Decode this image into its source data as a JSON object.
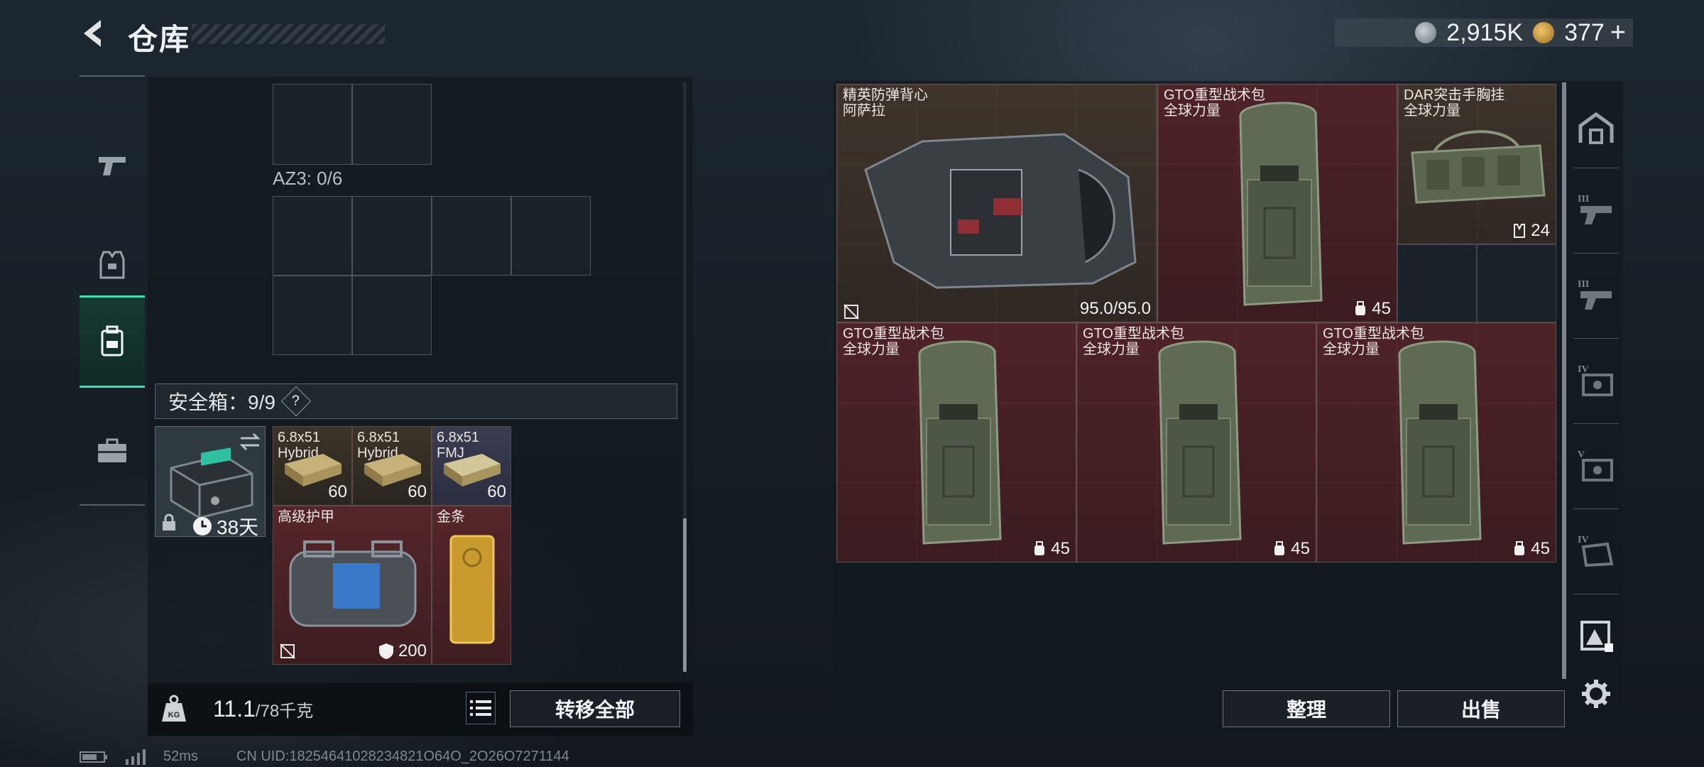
{
  "header": {
    "title": "仓库",
    "currency_1": "2,915K",
    "currency_2": "377",
    "plus": "+"
  },
  "left_storage": {
    "az3_label": "AZ3: 0/6",
    "safebox_label": "安全箱：9/9",
    "safebox_help": "?",
    "case_timer": "38天",
    "items": [
      {
        "name": "6.8x51\nHybrid",
        "count": "60"
      },
      {
        "name": "6.8x51\nHybrid",
        "count": "60"
      },
      {
        "name": "6.8x51\nFMJ",
        "count": "60"
      },
      {
        "name": "高级护甲",
        "count": "200"
      },
      {
        "name": "金条",
        "count": ""
      }
    ],
    "weight_current": "11.1",
    "weight_max": "/78千克",
    "transfer_all": "转移全部"
  },
  "right_storage": {
    "items": [
      {
        "name": "精英防弹背心",
        "sub": "阿萨拉",
        "value": "95.0/95.0"
      },
      {
        "name": "GTO重型战术包",
        "sub": "全球力量",
        "value": "45"
      },
      {
        "name": "DAR突击手胸挂",
        "sub": "全球力量",
        "value": "24"
      },
      {
        "name": "GTO重型战术包",
        "sub": "全球力量",
        "value": "45"
      },
      {
        "name": "GTO重型战术包",
        "sub": "全球力量",
        "value": "45"
      },
      {
        "name": "GTO重型战术包",
        "sub": "全球力量",
        "value": "45"
      }
    ],
    "sort_label": "整理",
    "sell_label": "出售"
  },
  "right_nav": {
    "tier_labels": [
      "III",
      "III",
      "IV",
      "V",
      "IV"
    ]
  },
  "status": {
    "ping": "52ms",
    "uid": "CN UID:18254641028234821O64O_2O26O7271144"
  },
  "colors": {
    "accent": "#3fe0b0",
    "slot_red": "#4e2328",
    "slot_brown": "#3e342c"
  }
}
